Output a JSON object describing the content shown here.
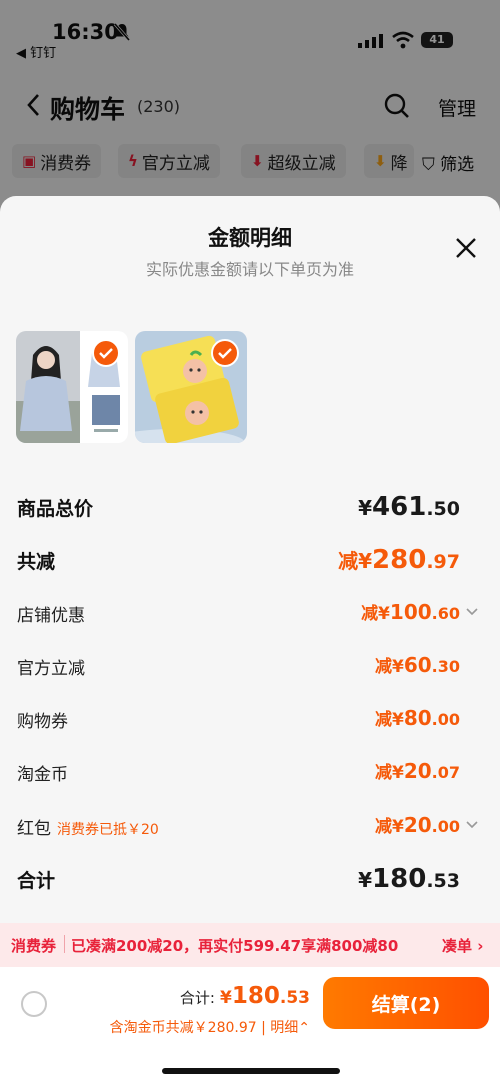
{
  "status_bar": {
    "time": "16:30",
    "back_app": "◀ 钉钉",
    "battery": "41"
  },
  "nav": {
    "title": "购物车",
    "count": "(230)",
    "manage": "管理"
  },
  "filters": [
    {
      "label": "消费券",
      "icon": "coupon-icon"
    },
    {
      "label": "官方立减",
      "icon": "lightning-icon"
    },
    {
      "label": "超级立减",
      "icon": "down-arrow-icon"
    },
    {
      "label": "降",
      "icon": "down-arrow-icon"
    }
  ],
  "filter_button": "筛选",
  "sheet": {
    "title": "金额明细",
    "subtitle": "实际优惠金额请以下单页为准"
  },
  "rows": {
    "subtotal": {
      "label": "商品总价",
      "pre": "¥",
      "int": "461",
      "dec": ".50"
    },
    "total_discount": {
      "label": "共减",
      "pre": "减¥",
      "int": "280",
      "dec": ".97"
    },
    "shop_discount": {
      "label": "店铺优惠",
      "pre": "减¥",
      "int": "100",
      "dec": ".60"
    },
    "official_discount": {
      "label": "官方立减",
      "pre": "减¥",
      "int": "60",
      "dec": ".30"
    },
    "shopping_coupon": {
      "label": "购物券",
      "pre": "减¥",
      "int": "80",
      "dec": ".00"
    },
    "taojinbi": {
      "label": "淘金币",
      "pre": "减¥",
      "int": "20",
      "dec": ".07"
    },
    "red_packet": {
      "label": "红包",
      "note": "消费券已抵￥20",
      "pre": "减¥",
      "int": "20",
      "dec": ".00"
    },
    "grand_total": {
      "label": "合计",
      "pre": "¥",
      "int": "180",
      "dec": ".53"
    }
  },
  "promo": {
    "tag": "消费券",
    "text": "已凑满200减20，再实付599.47享满800减80",
    "link": "凑单 ›"
  },
  "footer": {
    "total_label": "合计:",
    "total_pre": "¥",
    "total_int": "180",
    "total_dec": ".53",
    "saving": "含淘金币共减￥280.97 | 明细⌃",
    "checkout": "结算(2)"
  },
  "colors": {
    "accent": "#f55a0a",
    "promo_red": "#e8223a",
    "promo_bg": "#fde9ea"
  }
}
